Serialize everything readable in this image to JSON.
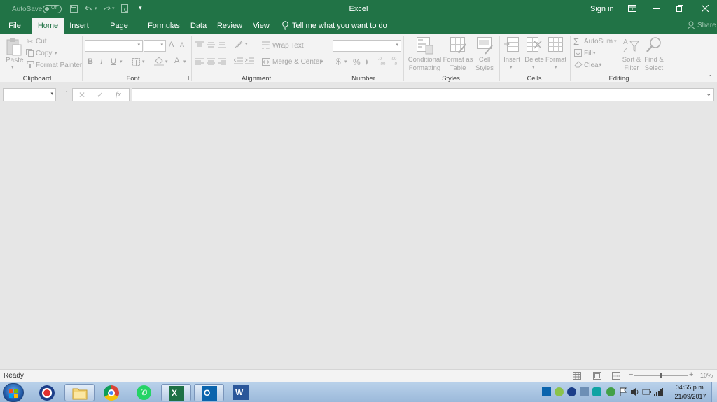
{
  "titlebar": {
    "autosave_label": "AutoSave",
    "autosave_state": "Off",
    "app_title": "Excel",
    "signin": "Sign in"
  },
  "tabs": [
    "File",
    "Home",
    "Insert",
    "Page Layout",
    "Formulas",
    "Data",
    "Review",
    "View"
  ],
  "tell_me": "Tell me what you want to do",
  "share": "Share",
  "ribbon": {
    "clipboard": {
      "paste": "Paste",
      "cut": "Cut",
      "copy": "Copy",
      "format_painter": "Format Painter",
      "label": "Clipboard"
    },
    "font": {
      "label": "Font",
      "bold": "B",
      "italic": "I",
      "underline": "U",
      "grow": "A",
      "shrink": "A",
      "color": "A"
    },
    "alignment": {
      "wrap_text": "Wrap Text",
      "merge_center": "Merge & Center",
      "label": "Alignment"
    },
    "number": {
      "currency": "$",
      "percent": "%",
      "label": "Number"
    },
    "styles": {
      "conditional_1": "Conditional",
      "conditional_2": "Formatting",
      "format_table_1": "Format as",
      "format_table_2": "Table",
      "cell_styles_1": "Cell",
      "cell_styles_2": "Styles",
      "label": "Styles"
    },
    "cells": {
      "insert": "Insert",
      "delete": "Delete",
      "format": "Format",
      "label": "Cells"
    },
    "editing": {
      "autosum": "AutoSum",
      "fill": "Fill",
      "clear": "Clear",
      "sort_1": "Sort &",
      "sort_2": "Filter",
      "find_1": "Find &",
      "find_2": "Select",
      "label": "Editing"
    }
  },
  "formula_bar": {
    "fx": "fx"
  },
  "status": {
    "ready": "Ready",
    "zoom": "10%"
  },
  "taskbar": {
    "time": "04:55 p.m.",
    "date": "21/09/2017"
  },
  "colors": {
    "accent": "#217346",
    "ribbon_bg": "#f3f3f3",
    "workspace_bg": "#e6e6e6"
  }
}
